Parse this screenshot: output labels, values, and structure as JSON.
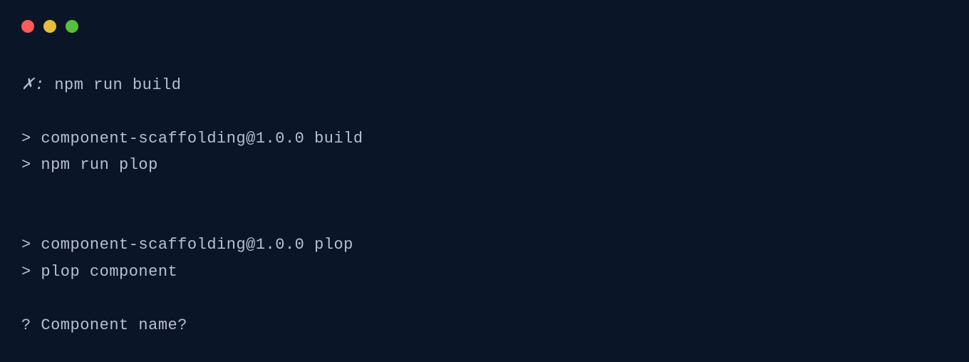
{
  "titlebar": {
    "close_color": "#fc5b57",
    "minimize_color": "#e5bf3c",
    "maximize_color": "#57c038"
  },
  "terminal": {
    "prompt_symbol": "✗:",
    "command": " npm run build",
    "lines": [
      "",
      "> component-scaffolding@1.0.0 build",
      "> npm run plop",
      "",
      "",
      "> component-scaffolding@1.0.0 plop",
      "> plop component",
      "",
      "? Component name?"
    ]
  }
}
